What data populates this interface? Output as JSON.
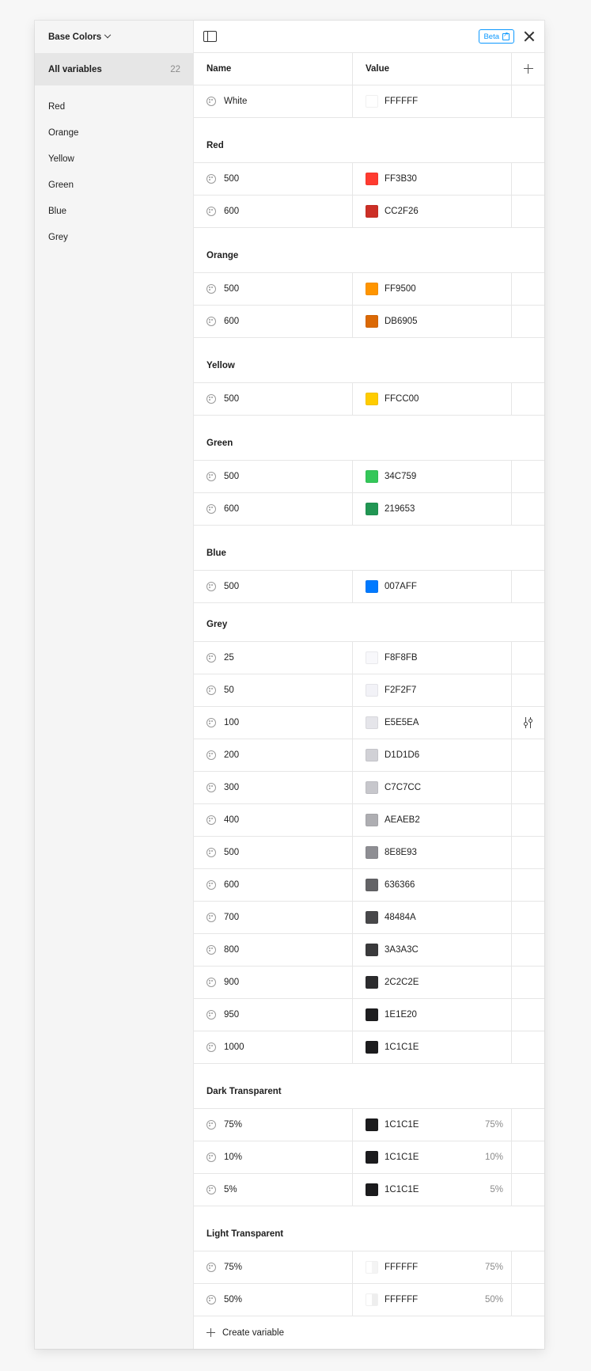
{
  "sidebar": {
    "collection": "Base Colors",
    "all_variables_label": "All variables",
    "all_variables_count": "22",
    "groups": [
      "Red",
      "Orange",
      "Yellow",
      "Green",
      "Blue",
      "Grey"
    ]
  },
  "topbar": {
    "beta_label": "Beta"
  },
  "table": {
    "name_header": "Name",
    "value_header": "Value"
  },
  "rows_top": [
    {
      "name": "White",
      "value": "FFFFFF",
      "color": "#FFFFFF"
    }
  ],
  "groups": [
    {
      "title": "Red",
      "rows": [
        {
          "name": "500",
          "value": "FF3B30",
          "color": "#FF3B30"
        },
        {
          "name": "600",
          "value": "CC2F26",
          "color": "#CC2F26"
        }
      ]
    },
    {
      "title": "Orange",
      "rows": [
        {
          "name": "500",
          "value": "FF9500",
          "color": "#FF9500"
        },
        {
          "name": "600",
          "value": "DB6905",
          "color": "#DB6905"
        }
      ]
    },
    {
      "title": "Yellow",
      "rows": [
        {
          "name": "500",
          "value": "FFCC00",
          "color": "#FFCC00"
        }
      ]
    },
    {
      "title": "Green",
      "rows": [
        {
          "name": "500",
          "value": "34C759",
          "color": "#34C759"
        },
        {
          "name": "600",
          "value": "219653",
          "color": "#219653"
        }
      ]
    },
    {
      "title": "Blue",
      "rows": [
        {
          "name": "500",
          "value": "007AFF",
          "color": "#007AFF"
        }
      ]
    },
    {
      "title": "Grey",
      "short": true,
      "rows": [
        {
          "name": "25",
          "value": "F8F8FB",
          "color": "#F8F8FB"
        },
        {
          "name": "50",
          "value": "F2F2F7",
          "color": "#F2F2F7"
        },
        {
          "name": "100",
          "value": "E5E5EA",
          "color": "#E5E5EA",
          "action": "tune"
        },
        {
          "name": "200",
          "value": "D1D1D6",
          "color": "#D1D1D6"
        },
        {
          "name": "300",
          "value": "C7C7CC",
          "color": "#C7C7CC"
        },
        {
          "name": "400",
          "value": "AEAEB2",
          "color": "#AEAEB2"
        },
        {
          "name": "500",
          "value": "8E8E93",
          "color": "#8E8E93"
        },
        {
          "name": "600",
          "value": "636366",
          "color": "#636366"
        },
        {
          "name": "700",
          "value": "48484A",
          "color": "#48484A"
        },
        {
          "name": "800",
          "value": "3A3A3C",
          "color": "#3A3A3C"
        },
        {
          "name": "900",
          "value": "2C2C2E",
          "color": "#2C2C2E"
        },
        {
          "name": "950",
          "value": "1E1E20",
          "color": "#1E1E20"
        },
        {
          "name": "1000",
          "value": "1C1C1E",
          "color": "#1C1C1E"
        }
      ]
    },
    {
      "title": "Dark Transparent",
      "rows": [
        {
          "name": "75%",
          "value": "1C1C1E",
          "pct": "75%",
          "color": "#1C1C1E",
          "half": "rgba(28,28,30,0.75)"
        },
        {
          "name": "10%",
          "value": "1C1C1E",
          "pct": "10%",
          "color": "#1C1C1E",
          "half": "rgba(28,28,30,0.15)"
        },
        {
          "name": "5%",
          "value": "1C1C1E",
          "pct": "5%",
          "color": "#1C1C1E",
          "half": "rgba(28,28,30,0.08)"
        }
      ]
    },
    {
      "title": "Light Transparent",
      "rows": [
        {
          "name": "75%",
          "value": "FFFFFF",
          "pct": "75%",
          "color": "#FFFFFF",
          "half": "#f4f4f4"
        },
        {
          "name": "50%",
          "value": "FFFFFF",
          "pct": "50%",
          "color": "#FFFFFF",
          "half": "#eeeeee"
        }
      ]
    }
  ],
  "footer": {
    "create_label": "Create variable"
  }
}
